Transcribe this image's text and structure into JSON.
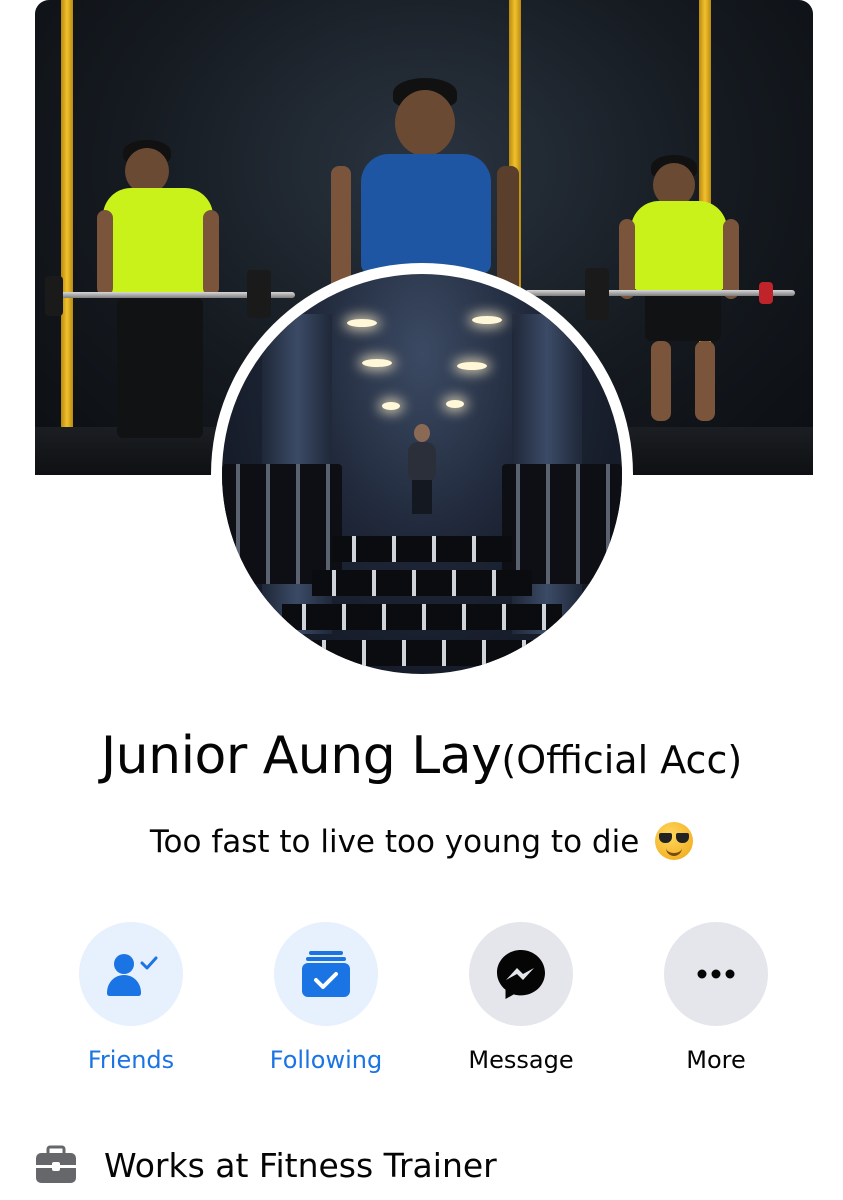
{
  "profile": {
    "name": "Junior Aung Lay",
    "name_suffix": "(Official Acc)",
    "bio": "Too fast to live too young to die",
    "bio_emoji": "smiling-face-with-sunglasses"
  },
  "actions": [
    {
      "label": "Friends",
      "icon": "friends-check-icon",
      "style": "active"
    },
    {
      "label": "Following",
      "icon": "following-check-icon",
      "style": "active"
    },
    {
      "label": "Message",
      "icon": "messenger-icon",
      "style": "default"
    },
    {
      "label": "More",
      "icon": "more-dots-icon",
      "style": "default"
    }
  ],
  "intro": {
    "work": "Works at Fitness Trainer",
    "work_icon": "briefcase-icon"
  },
  "colors": {
    "accent": "#1b74e4",
    "accent_bg": "#e7f0fd",
    "neutral_bg": "#e4e6eb",
    "text": "#050505"
  }
}
